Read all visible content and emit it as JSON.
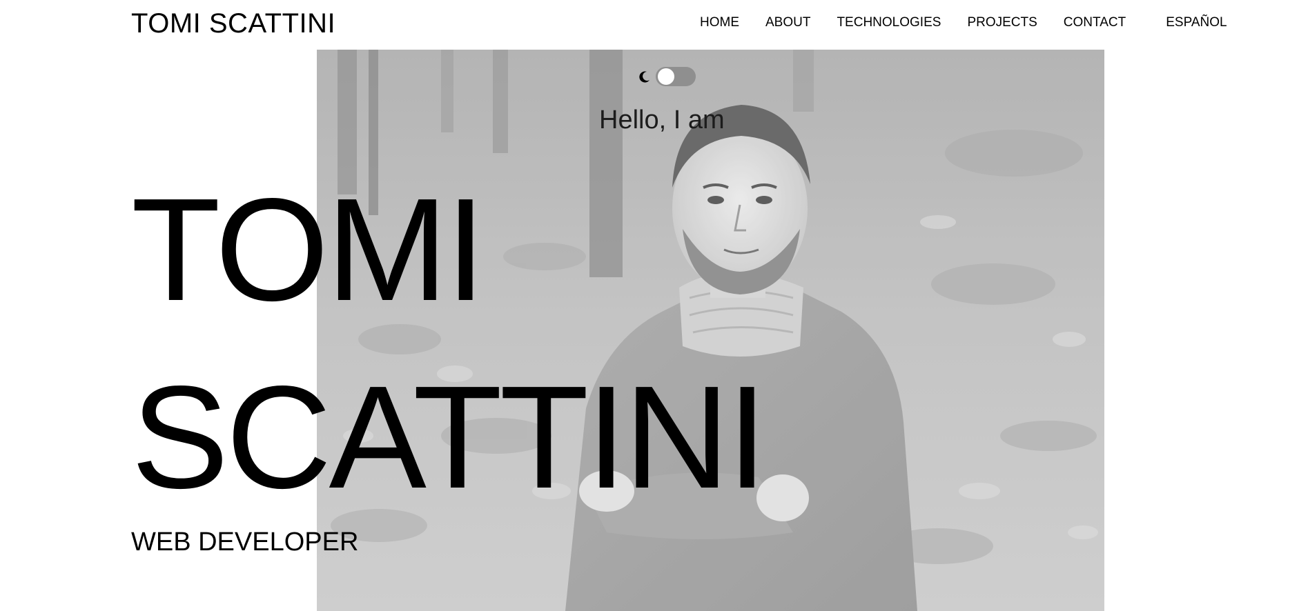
{
  "header": {
    "brand": "TOMI SCATTINI",
    "nav": [
      {
        "label": "HOME"
      },
      {
        "label": "ABOUT"
      },
      {
        "label": "TECHNOLOGIES"
      },
      {
        "label": "PROJECTS"
      },
      {
        "label": "CONTACT"
      }
    ],
    "language_label": "ESPAÑOL"
  },
  "theme_toggle": {
    "icon": "moon-icon",
    "state": "off"
  },
  "hero": {
    "greeting": "Hello, I am",
    "first_name": "TOMI",
    "last_name": "SCATTINI",
    "role": "WEB DEVELOPER",
    "photo": "portrait-photo"
  },
  "colors": {
    "background": "#ffffff",
    "text": "#000000",
    "toggle_track": "#8f8f8f",
    "photo_tone": "#b9b9b9"
  }
}
